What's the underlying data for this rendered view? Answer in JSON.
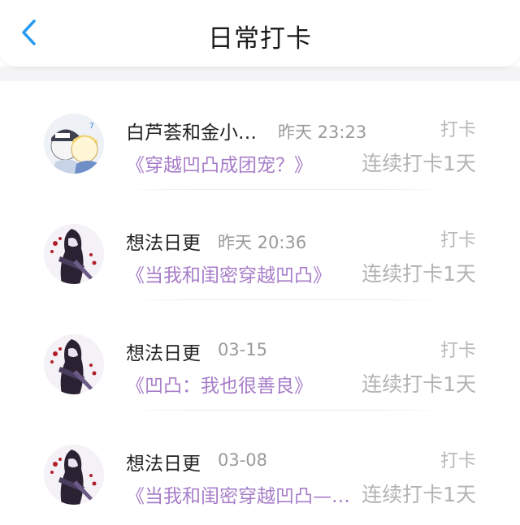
{
  "header": {
    "title": "日常打卡",
    "back_icon": "chevron-left-icon",
    "accent_color": "#2b9bf0"
  },
  "colors": {
    "book_title": "#a77dc9",
    "muted": "#b3b3b3"
  },
  "entries": [
    {
      "name": "白芦荟和金小…",
      "time": "昨天 23:23",
      "action": "打卡",
      "book": "《穿越凹凸成团宠？》",
      "streak": "连续打卡1天"
    },
    {
      "name": "想法日更",
      "time": "昨天 20:36",
      "action": "打卡",
      "book": "《当我和闺密穿越凹凸》",
      "streak": "连续打卡1天"
    },
    {
      "name": "想法日更",
      "time": "03-15",
      "action": "打卡",
      "book": "《凹凸：我也很善良》",
      "streak": "连续打卡1天"
    },
    {
      "name": "想法日更",
      "time": "03-08",
      "action": "打卡",
      "book": "《当我和闺密穿越凹凸—…",
      "streak": "连续打卡1天"
    }
  ]
}
